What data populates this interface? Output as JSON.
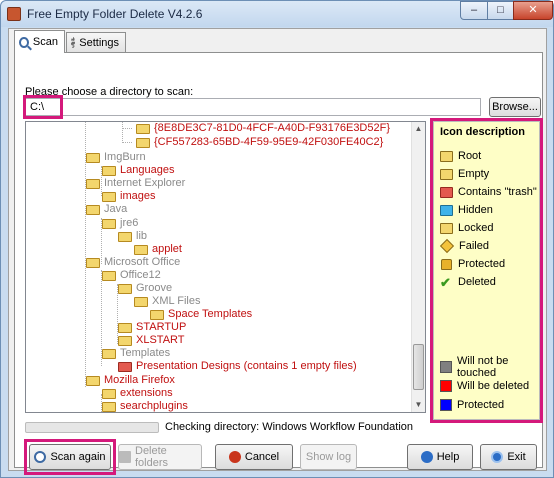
{
  "window": {
    "title": "Free Empty Folder Delete V4.2.6",
    "min": "–",
    "max": "□",
    "close": "✕"
  },
  "tabs": [
    {
      "label": "Scan",
      "icon": "magnifier-icon"
    },
    {
      "label": "Settings",
      "icon": "gear-icon"
    }
  ],
  "choose_label": "Please choose a directory to scan:",
  "path_value": "C:\\",
  "browse_label": "Browse...",
  "tree": [
    {
      "label": "{8E8DE3C7-81D0-4FCF-A40D-F93176E3D52F}",
      "style": "red",
      "icon": "folder"
    },
    {
      "label": "{CF557283-65BD-4F59-95E9-42F030FE40C2}",
      "style": "red",
      "icon": "folder"
    },
    {
      "label": "ImgBurn",
      "style": "gray",
      "icon": "folder"
    },
    {
      "label": "Languages",
      "style": "red",
      "icon": "folder"
    },
    {
      "label": "Internet Explorer",
      "style": "gray",
      "icon": "folder"
    },
    {
      "label": "images",
      "style": "red",
      "icon": "folder"
    },
    {
      "label": "Java",
      "style": "gray",
      "icon": "folder"
    },
    {
      "label": "jre6",
      "style": "gray",
      "icon": "folder"
    },
    {
      "label": "lib",
      "style": "gray",
      "icon": "folder"
    },
    {
      "label": "applet",
      "style": "red",
      "icon": "folder"
    },
    {
      "label": "Microsoft Office",
      "style": "gray",
      "icon": "folder"
    },
    {
      "label": "Office12",
      "style": "gray",
      "icon": "folder"
    },
    {
      "label": "Groove",
      "style": "gray",
      "icon": "folder"
    },
    {
      "label": "XML Files",
      "style": "gray",
      "icon": "folder"
    },
    {
      "label": "Space Templates",
      "style": "red",
      "icon": "folder"
    },
    {
      "label": "STARTUP",
      "style": "red",
      "icon": "folder"
    },
    {
      "label": "XLSTART",
      "style": "red",
      "icon": "folder"
    },
    {
      "label": "Templates",
      "style": "gray",
      "icon": "folder"
    },
    {
      "label": "Presentation Designs (contains 1 empty files)",
      "style": "red",
      "icon": "trash-folder"
    },
    {
      "label": "Mozilla Firefox",
      "style": "red",
      "icon": "folder"
    },
    {
      "label": "extensions",
      "style": "red",
      "icon": "folder"
    },
    {
      "label": "searchplugins",
      "style": "red",
      "icon": "folder"
    }
  ],
  "legend": {
    "title": "Icon description",
    "items": [
      {
        "label": "Root",
        "icon": "root-folder-icon"
      },
      {
        "label": "Empty",
        "icon": "empty-folder-icon"
      },
      {
        "label": "Contains \"trash\"",
        "icon": "trash-folder-icon"
      },
      {
        "label": "Hidden",
        "icon": "hidden-folder-icon"
      },
      {
        "label": "Locked",
        "icon": "locked-folder-icon"
      },
      {
        "label": "Failed",
        "icon": "failed-icon"
      },
      {
        "label": "Protected",
        "icon": "lock-icon"
      },
      {
        "label": "Deleted",
        "icon": "checkmark-icon"
      }
    ],
    "colors": [
      {
        "label": "Will not be touched",
        "color": "#808080"
      },
      {
        "label": "Will be deleted",
        "color": "#ff0000"
      },
      {
        "label": "Protected",
        "color": "#0000ff"
      }
    ]
  },
  "status": {
    "checking": "Checking directory: Windows Workflow Foundation"
  },
  "buttons": {
    "scan_again": "Scan again",
    "delete_folders": "Delete folders",
    "cancel": "Cancel",
    "show_log": "Show log",
    "help": "Help",
    "exit": "Exit"
  }
}
